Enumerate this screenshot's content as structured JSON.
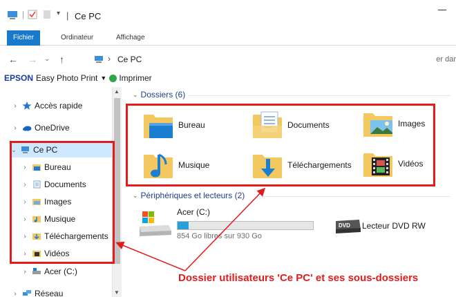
{
  "window": {
    "title": "Ce PC",
    "title_separator": "|"
  },
  "ribbon": {
    "tabs": [
      "Fichier",
      "Ordinateur",
      "Affichage"
    ],
    "active_tab_color": "#1979ca"
  },
  "address_bar": {
    "path": "Ce PC",
    "search_fragment": "er dar"
  },
  "epson_toolbar": {
    "brand": "EPSON",
    "app": "Easy Photo Print",
    "print_label": "Imprimer"
  },
  "sidebar": {
    "items": [
      {
        "label": "Accès rapide",
        "icon": "star-icon"
      },
      {
        "label": "OneDrive",
        "icon": "cloud-icon"
      },
      {
        "label": "Ce PC",
        "icon": "computer-icon",
        "selected": true,
        "expanded": true
      },
      {
        "label": "Bureau",
        "icon": "desktop-folder-icon"
      },
      {
        "label": "Documents",
        "icon": "documents-folder-icon"
      },
      {
        "label": "Images",
        "icon": "pictures-folder-icon"
      },
      {
        "label": "Musique",
        "icon": "music-folder-icon"
      },
      {
        "label": "Téléchargements",
        "icon": "downloads-folder-icon"
      },
      {
        "label": "Vidéos",
        "icon": "videos-folder-icon"
      },
      {
        "label": "Acer (C:)",
        "icon": "drive-icon"
      },
      {
        "label": "Réseau",
        "icon": "network-icon"
      }
    ]
  },
  "content": {
    "folders_header": "Dossiers (6)",
    "folders": [
      {
        "label": "Bureau",
        "icon": "desktop-folder-icon"
      },
      {
        "label": "Documents",
        "icon": "documents-folder-icon"
      },
      {
        "label": "Images",
        "icon": "pictures-folder-icon"
      },
      {
        "label": "Musique",
        "icon": "music-folder-icon"
      },
      {
        "label": "Téléchargements",
        "icon": "downloads-folder-icon"
      },
      {
        "label": "Vidéos",
        "icon": "videos-folder-icon"
      }
    ],
    "devices_header": "Périphériques et lecteurs (2)",
    "drives": [
      {
        "label": "Acer (C:)",
        "space": "854 Go libres sur 930 Go",
        "used_fraction": 0.08,
        "icon": "hard-drive-icon"
      },
      {
        "label": "Lecteur DVD RW",
        "icon": "dvd-drive-icon"
      }
    ]
  },
  "annotation": {
    "text": "Dossier utilisateurs 'Ce PC' et ses sous-dossiers",
    "color": "#e21c1c"
  }
}
